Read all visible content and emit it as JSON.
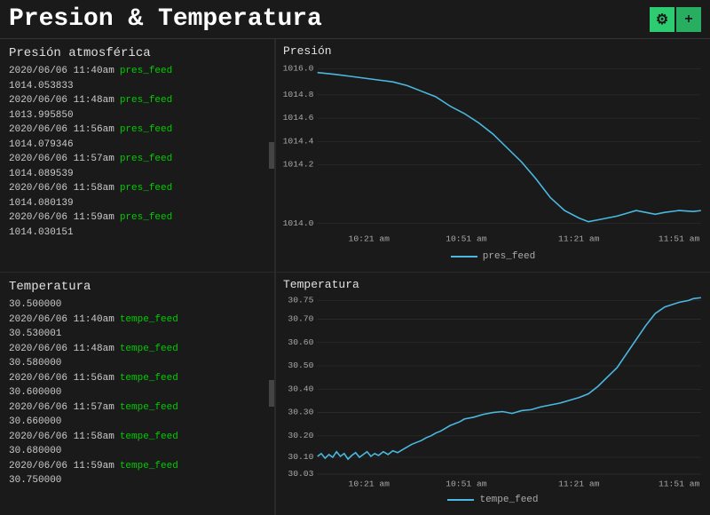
{
  "header": {
    "title": "Presion & Temperatura",
    "gear_label": "⚙",
    "plus_label": "+"
  },
  "pressure_panel": {
    "title": "Presión atmosférica",
    "entries": [
      {
        "date": "2020/06/06 11:40am",
        "tag": "pres_feed",
        "value": "1014.053833"
      },
      {
        "date": "2020/06/06 11:48am",
        "tag": "pres_feed",
        "value": "1013.995850"
      },
      {
        "date": "2020/06/06 11:56am",
        "tag": "pres_feed",
        "value": "1014.079346"
      },
      {
        "date": "2020/06/06 11:57am",
        "tag": "pres_feed",
        "value": "1014.089539"
      },
      {
        "date": "2020/06/06 11:58am",
        "tag": "pres_feed",
        "value": "1014.080139"
      },
      {
        "date": "2020/06/06 11:59am",
        "tag": "pres_feed",
        "value": "1014.030151"
      }
    ]
  },
  "pressure_chart": {
    "title": "Presión",
    "legend": "pres_feed",
    "y_labels": [
      "1016.0",
      "1014.8",
      "1014.6",
      "1014.4",
      "1014.2",
      "1014.0"
    ],
    "x_labels": [
      "10:21 am",
      "10:51 am",
      "11:21 am",
      "11:51 am"
    ],
    "color": "#4ab8e0"
  },
  "temperature_panel": {
    "title": "Temperatura",
    "entries": [
      {
        "date": "2020/06/06 11:40am",
        "tag": "tempe_feed",
        "value": "30.530001"
      },
      {
        "date": "2020/06/06 11:48am",
        "tag": "tempe_feed",
        "value": "30.580000"
      },
      {
        "date": "2020/06/06 11:56am",
        "tag": "tempe_feed",
        "value": "30.600000"
      },
      {
        "date": "2020/06/06 11:57am",
        "tag": "tempe_feed",
        "value": "30.660000"
      },
      {
        "date": "2020/06/06 11:58am",
        "tag": "tempe_feed",
        "value": "30.680000"
      },
      {
        "date": "2020/06/06 11:59am",
        "tag": "tempe_feed",
        "value": "30.750000"
      }
    ]
  },
  "temperature_chart": {
    "title": "Temperatura",
    "legend": "tempe_feed",
    "y_labels": [
      "30.75",
      "30.70",
      "30.60",
      "30.50",
      "30.40",
      "30.30",
      "30.20",
      "30.10",
      "30.03"
    ],
    "x_labels": [
      "10:21 am",
      "10:51 am",
      "11:21 am",
      "11:51 am"
    ],
    "color": "#4ab8e0"
  }
}
